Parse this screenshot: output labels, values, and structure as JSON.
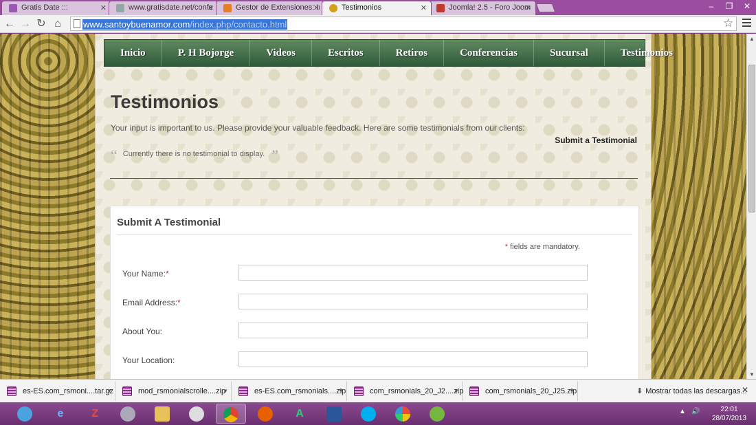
{
  "browser": {
    "tabs": [
      {
        "title": "Gratis Date :::",
        "fav_color": "#9b59b6"
      },
      {
        "title": "www.gratisdate.net/confe",
        "fav_color": "#95a5a6"
      },
      {
        "title": "Gestor de Extensiones: Ins",
        "fav_color": "#e67e22"
      },
      {
        "title": "Testimonios",
        "fav_color": "#d4a017"
      },
      {
        "title": "Joomla! 2.5 - Foro Joomla",
        "fav_color": "#c0392b"
      }
    ],
    "url_host": "www.santoybuenamor.com",
    "url_path": "/index.php/contacto.html"
  },
  "nav": {
    "items": [
      "Inicio",
      "P. H Bojorge",
      "Videos",
      "Escritos",
      "Retiros",
      "Conferencias",
      "Sucursal",
      "Testimonios"
    ]
  },
  "page": {
    "title": "Testimonios",
    "intro": "Your input is important to us. Please provide your valuable feedback. Here are some testimonials from our clients:",
    "submit_link": "Submit a Testimonial",
    "quote_open": "“",
    "quote_close": "”",
    "empty_msg": "Currently there is no testimonial to display."
  },
  "form": {
    "title": "Submit A Testimonial",
    "mandatory_asterisk": "*",
    "mandatory_note": " fields are mandatory.",
    "fields": [
      {
        "label": "Your Name:",
        "required": "*"
      },
      {
        "label": "Email Address:",
        "required": "*"
      },
      {
        "label": "About You:",
        "required": ""
      },
      {
        "label": "Your Location:",
        "required": ""
      }
    ]
  },
  "downloads": {
    "items": [
      "es-ES.com_rsmoni....tar.gz",
      "mod_rsmonialscrolle....zip",
      "es-ES.com_rsmonials....zip",
      "com_rsmonials_20_J2....zip",
      "com_rsmonials_20_J25.zip"
    ],
    "show_all": "Mostrar todas las descargas..."
  },
  "taskbar": {
    "time": "22:01",
    "date": "28/07/2013"
  }
}
